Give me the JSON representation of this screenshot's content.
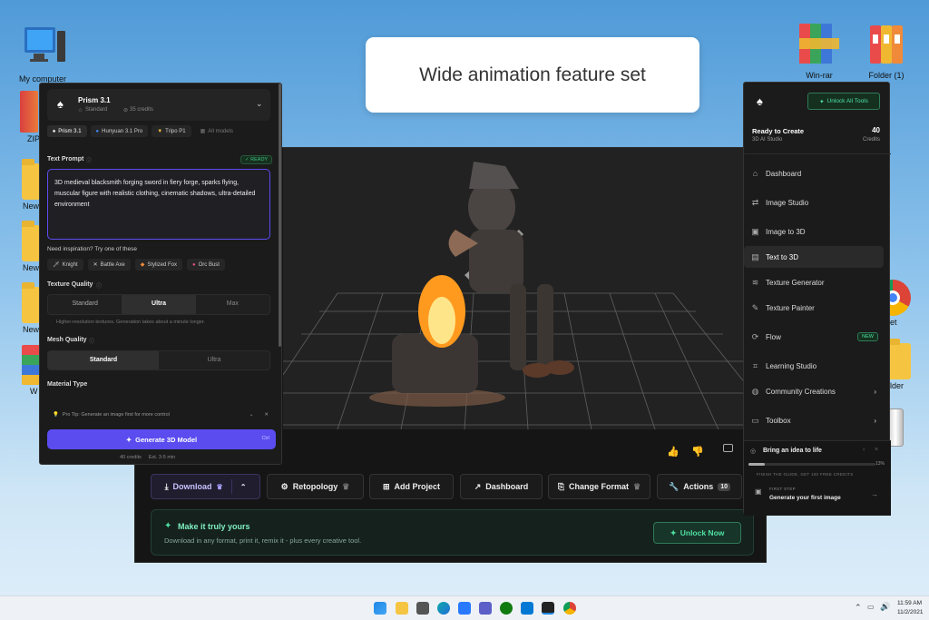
{
  "caption": "Wide animation feature set",
  "desktop": {
    "my_computer": "My computer",
    "zip": "ZIP",
    "new1": "New",
    "new2": "New",
    "new3": "New",
    "w": "W",
    "winrar": "Win-rar",
    "folder1": "Folder (1)",
    "net": "net",
    "folder": "older"
  },
  "left_panel": {
    "model_name": "Prism 3.1",
    "model_tier": "Standard",
    "model_credits": "35 credits",
    "chips": [
      "Prism 3.1",
      "Hunyuan 3.1 Pro",
      "Tripo P1",
      "All models"
    ],
    "text_prompt_label": "Text Prompt",
    "ready_badge": "✓ READY",
    "prompt_text": "3D medieval blacksmith forging sword in fiery forge, sparks flying, muscular figure with realistic clothing, cinematic shadows, ultra-detailed environment",
    "inspiration_label": "Need inspiration? Try one of these",
    "inspirations": [
      "Knight",
      "Battle Axe",
      "Stylized Fox",
      "Orc Bust"
    ],
    "texture_label": "Texture Quality",
    "texture_options": [
      "Standard",
      "Ultra",
      "Max"
    ],
    "texture_note": "Higher-resolution textures. Generation takes about a minute longer.",
    "mesh_label": "Mesh Quality",
    "mesh_options": [
      "Standard",
      "Ultra"
    ],
    "material_label": "Material Type",
    "pro_tip": "Pro Tip: Generate an image first for more control",
    "generate_button": "Generate 3D Model",
    "generate_shortcut": "Ctrl",
    "cost": "40 credits",
    "eta": "Est. 3-5 min"
  },
  "toolbar": {
    "download": "Download",
    "retopology": "Retopology",
    "add_project": "Add Project",
    "dashboard": "Dashboard",
    "change_format": "Change Format",
    "actions": "Actions",
    "actions_count": "10"
  },
  "promo": {
    "title": "Make it truly yours",
    "subtitle": "Download in any format, print it, remix it - plus every creative tool.",
    "button": "Unlock Now"
  },
  "right_panel": {
    "unlock_button": "Unlock All Tools",
    "status_title": "Ready to Create",
    "status_sub": "3D AI Studio",
    "credits_value": "40",
    "credits_label": "Credits",
    "nav": [
      "Dashboard",
      "Image Studio",
      "Image to 3D",
      "Text to 3D",
      "Texture Generator",
      "Texture Painter",
      "Flow",
      "Learning Studio",
      "Community Creations",
      "Toolbox"
    ],
    "new_badge": "NEW",
    "guide_title": "Bring an idea to life",
    "guide_percent": "13%",
    "guide_note": "FINISH THE GUIDE, GET 100 FREE CREDITS",
    "step_label": "FIRST STEP",
    "step_title": "Generate your first image",
    "guide_progress": 0.13
  },
  "taskbar": {
    "time": "11:59 AM",
    "date": "11/2/2021"
  },
  "colors": {
    "accent_purple": "#5b4cf0",
    "ready_green": "#3fbf7f",
    "unlock_green": "#4ee0a0",
    "viewport_bg": "#222222"
  }
}
